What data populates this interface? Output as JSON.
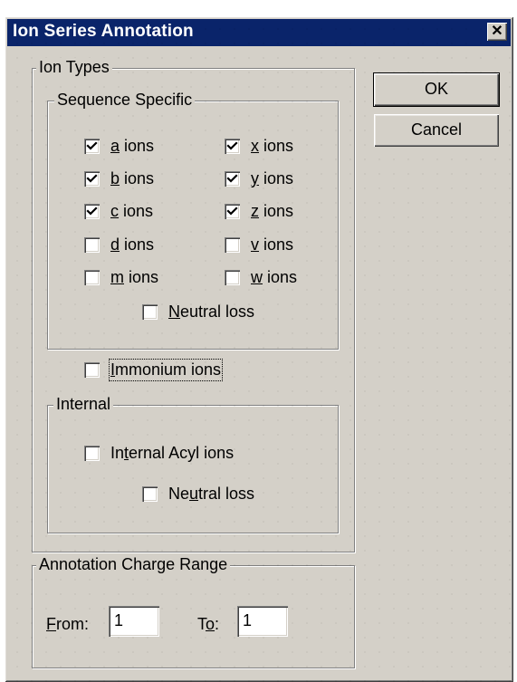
{
  "window": {
    "title": "Ion Series Annotation",
    "close_glyph": "✕"
  },
  "buttons": {
    "ok": "OK",
    "cancel": "Cancel"
  },
  "ion_types": {
    "legend": "Ion Types",
    "sequence_specific": {
      "legend": "Sequence Specific",
      "items": [
        {
          "mnemonic": "a",
          "rest": " ions",
          "checked": true
        },
        {
          "mnemonic": "x",
          "rest": " ions",
          "checked": true
        },
        {
          "mnemonic": "b",
          "rest": " ions",
          "checked": true
        },
        {
          "mnemonic": "y",
          "rest": " ions",
          "checked": true
        },
        {
          "mnemonic": "c",
          "rest": " ions",
          "checked": true
        },
        {
          "mnemonic": "z",
          "rest": " ions",
          "checked": true
        },
        {
          "mnemonic": "d",
          "rest": " ions",
          "checked": false
        },
        {
          "mnemonic": "v",
          "rest": " ions",
          "checked": false
        },
        {
          "mnemonic": "m",
          "rest": " ions",
          "checked": false
        },
        {
          "mnemonic": "w",
          "rest": " ions",
          "checked": false
        }
      ],
      "neutral_loss": {
        "mnemonic": "N",
        "rest": "eutral loss",
        "checked": false
      }
    },
    "immonium": {
      "mnemonic": "I",
      "rest": "mmonium ions",
      "checked": false
    },
    "internal": {
      "legend": "Internal",
      "acyl": {
        "pre": "In",
        "mnemonic": "t",
        "rest": "ernal Acyl ions",
        "checked": false
      },
      "neutral_loss": {
        "pre": "Ne",
        "mnemonic": "u",
        "rest": "tral loss",
        "checked": false
      }
    }
  },
  "charge_range": {
    "legend": "Annotation Charge Range",
    "from_mnemonic": "F",
    "from_rest": "rom:",
    "from_value": "1",
    "to_pre": "T",
    "to_mnemonic": "o",
    "to_rest": ":",
    "to_value": "1"
  }
}
